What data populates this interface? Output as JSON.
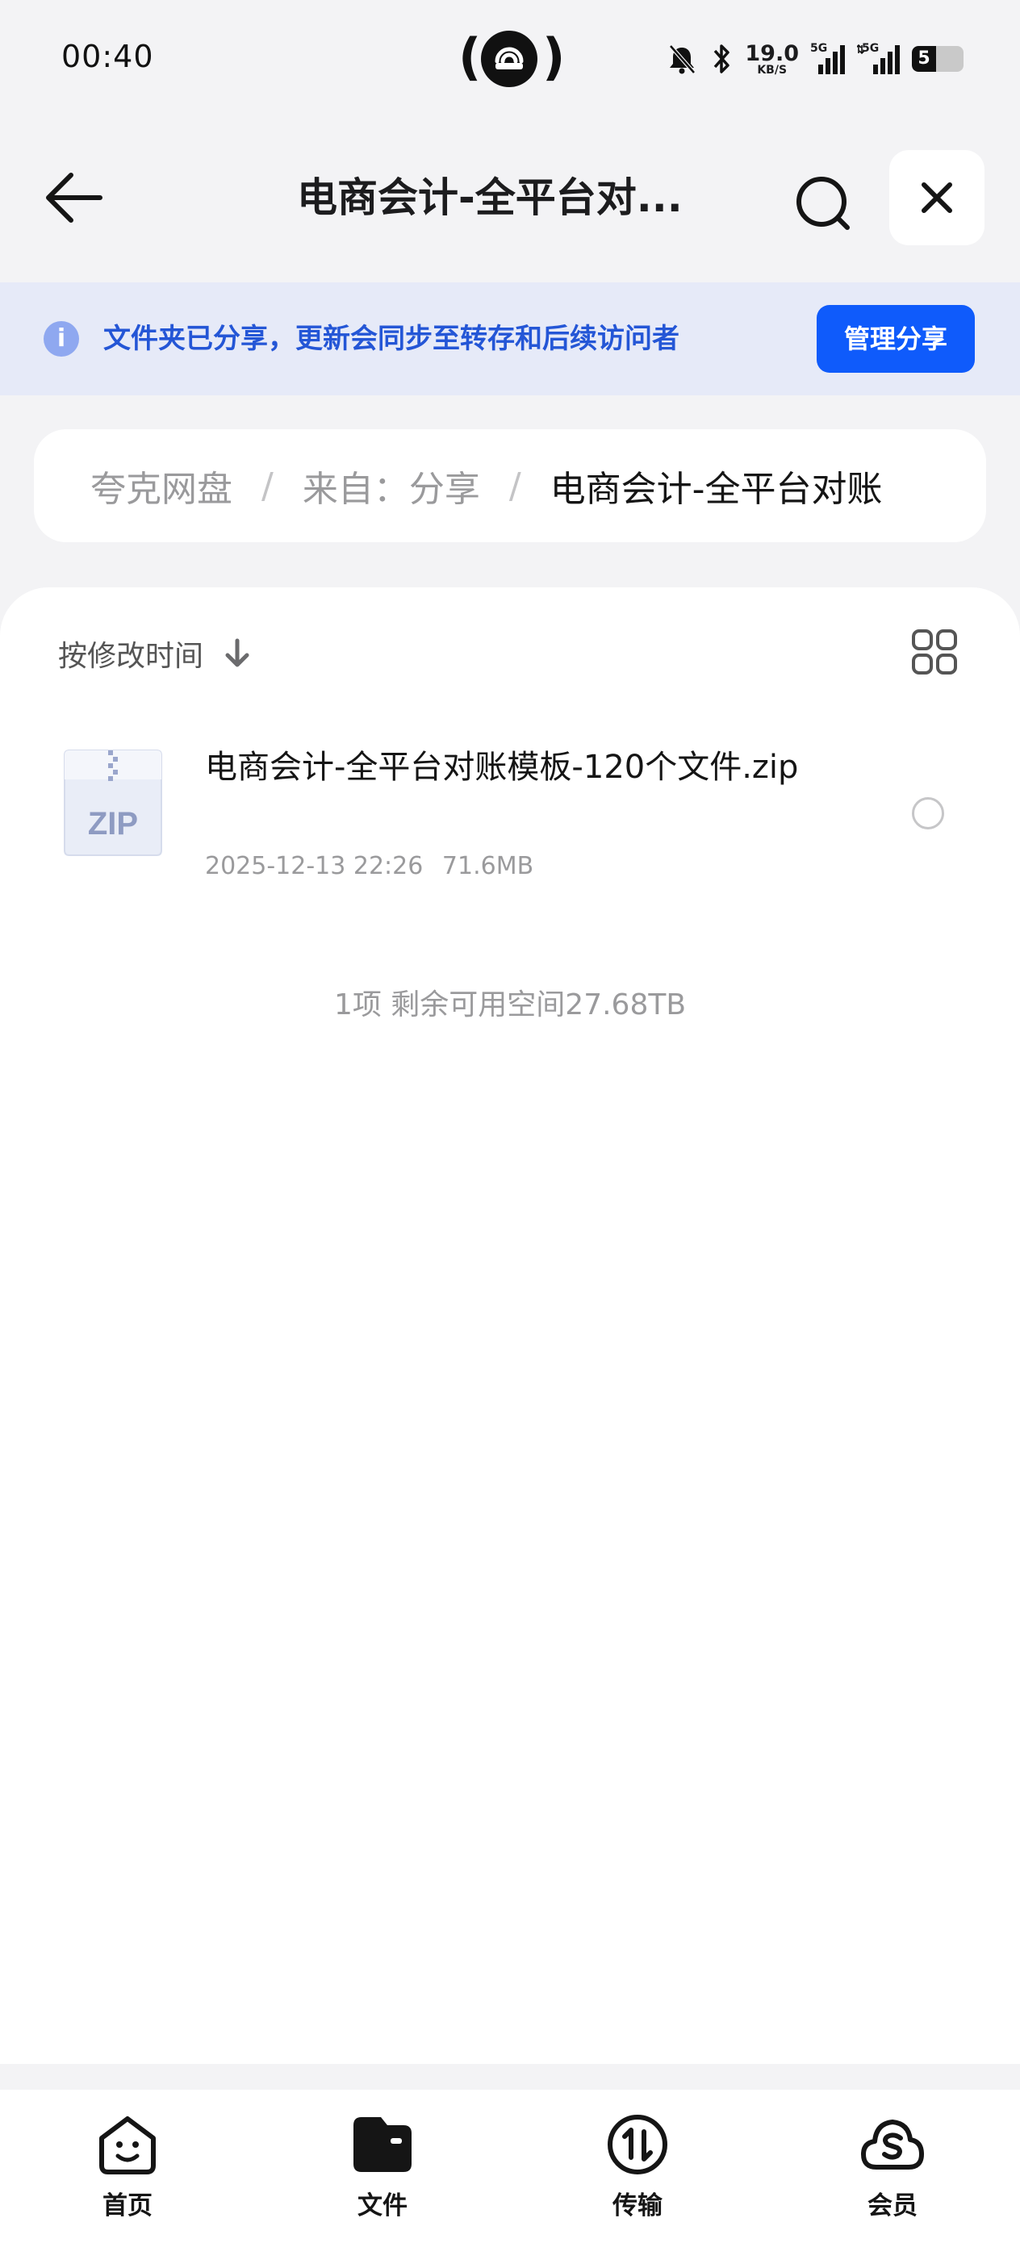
{
  "status_bar": {
    "time": "00:40",
    "net_speed": "19.0",
    "net_speed_unit": "KB/S",
    "signal_1_label": "5G",
    "signal_2_label": "5G",
    "battery": "5"
  },
  "header": {
    "title": "电商会计-全平台对..."
  },
  "share_notice": {
    "text": "文件夹已分享，更新会同步至转存和后续访问者",
    "manage_label": "管理分享"
  },
  "breadcrumb": [
    {
      "label": "夸克网盘"
    },
    {
      "label": "来自：分享"
    },
    {
      "label": "电商会计-全平台对账"
    }
  ],
  "breadcrumb_separator": "/",
  "file_list": {
    "sort_label": "按修改时间",
    "items": [
      {
        "icon_label": "ZIP",
        "name": "电商会计-全平台对账模板-120个文件.zip",
        "date": "2025-12-13 22:26",
        "size": "71.6MB"
      }
    ],
    "summary": "1项 剩余可用空间27.68TB"
  },
  "bottom_nav": [
    {
      "label": "首页",
      "icon": "home-smile-icon"
    },
    {
      "label": "文件",
      "icon": "folder-icon"
    },
    {
      "label": "传输",
      "icon": "transfer-icon"
    },
    {
      "label": "会员",
      "icon": "member-cloud-icon"
    }
  ],
  "colors": {
    "accent": "#0f5bfb",
    "notice_bg": "#e6eaf8",
    "notice_text": "#2456d6",
    "page_bg": "#f3f3f5"
  }
}
